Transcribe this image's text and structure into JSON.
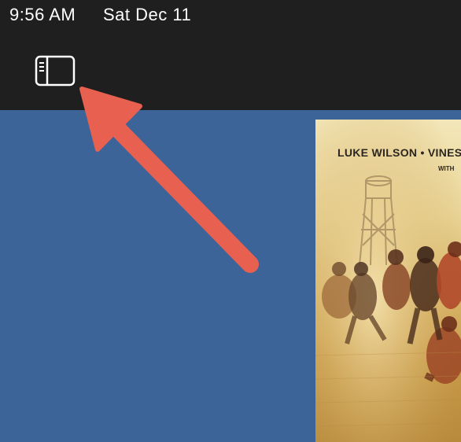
{
  "status_bar": {
    "time": "9:56 AM",
    "date": "Sat Dec 11"
  },
  "toolbar": {
    "sidebar_toggle_icon": "sidebar-icon"
  },
  "poster": {
    "credits_line": "LUKE WILSON • VINES",
    "with_line": "WITH"
  },
  "annotation": {
    "arrow_color": "#e8604f",
    "points_to": "sidebar-toggle-button"
  },
  "colors": {
    "topbar": "#201f20",
    "background": "#3c6499",
    "icon": "#ffffff"
  }
}
